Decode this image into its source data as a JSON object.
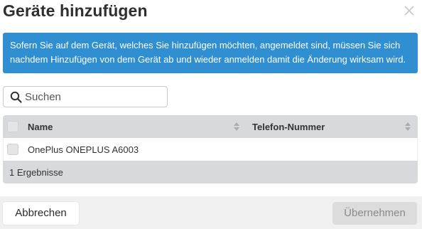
{
  "dialog": {
    "title": "Geräte hinzufügen",
    "info_text": "Sofern Sie auf dem Gerät, welches Sie hinzufügen möchten, angemeldet sind, müssen Sie sich nachdem Hinzufügen von dem Gerät ab und wieder anmelden damit die Änderung wirksam wird.",
    "info_color": "#2f8fd1"
  },
  "search": {
    "placeholder": "Suchen",
    "value": "",
    "icon": "search-icon"
  },
  "table": {
    "columns": [
      "Name",
      "Telefon-Nummer"
    ],
    "rows": [
      {
        "name": "OnePlus ONEPLUS A6003",
        "phone": ""
      }
    ],
    "footer": "1 Ergebnisse"
  },
  "buttons": {
    "cancel": "Abbrechen",
    "confirm": "Übernehmen"
  }
}
